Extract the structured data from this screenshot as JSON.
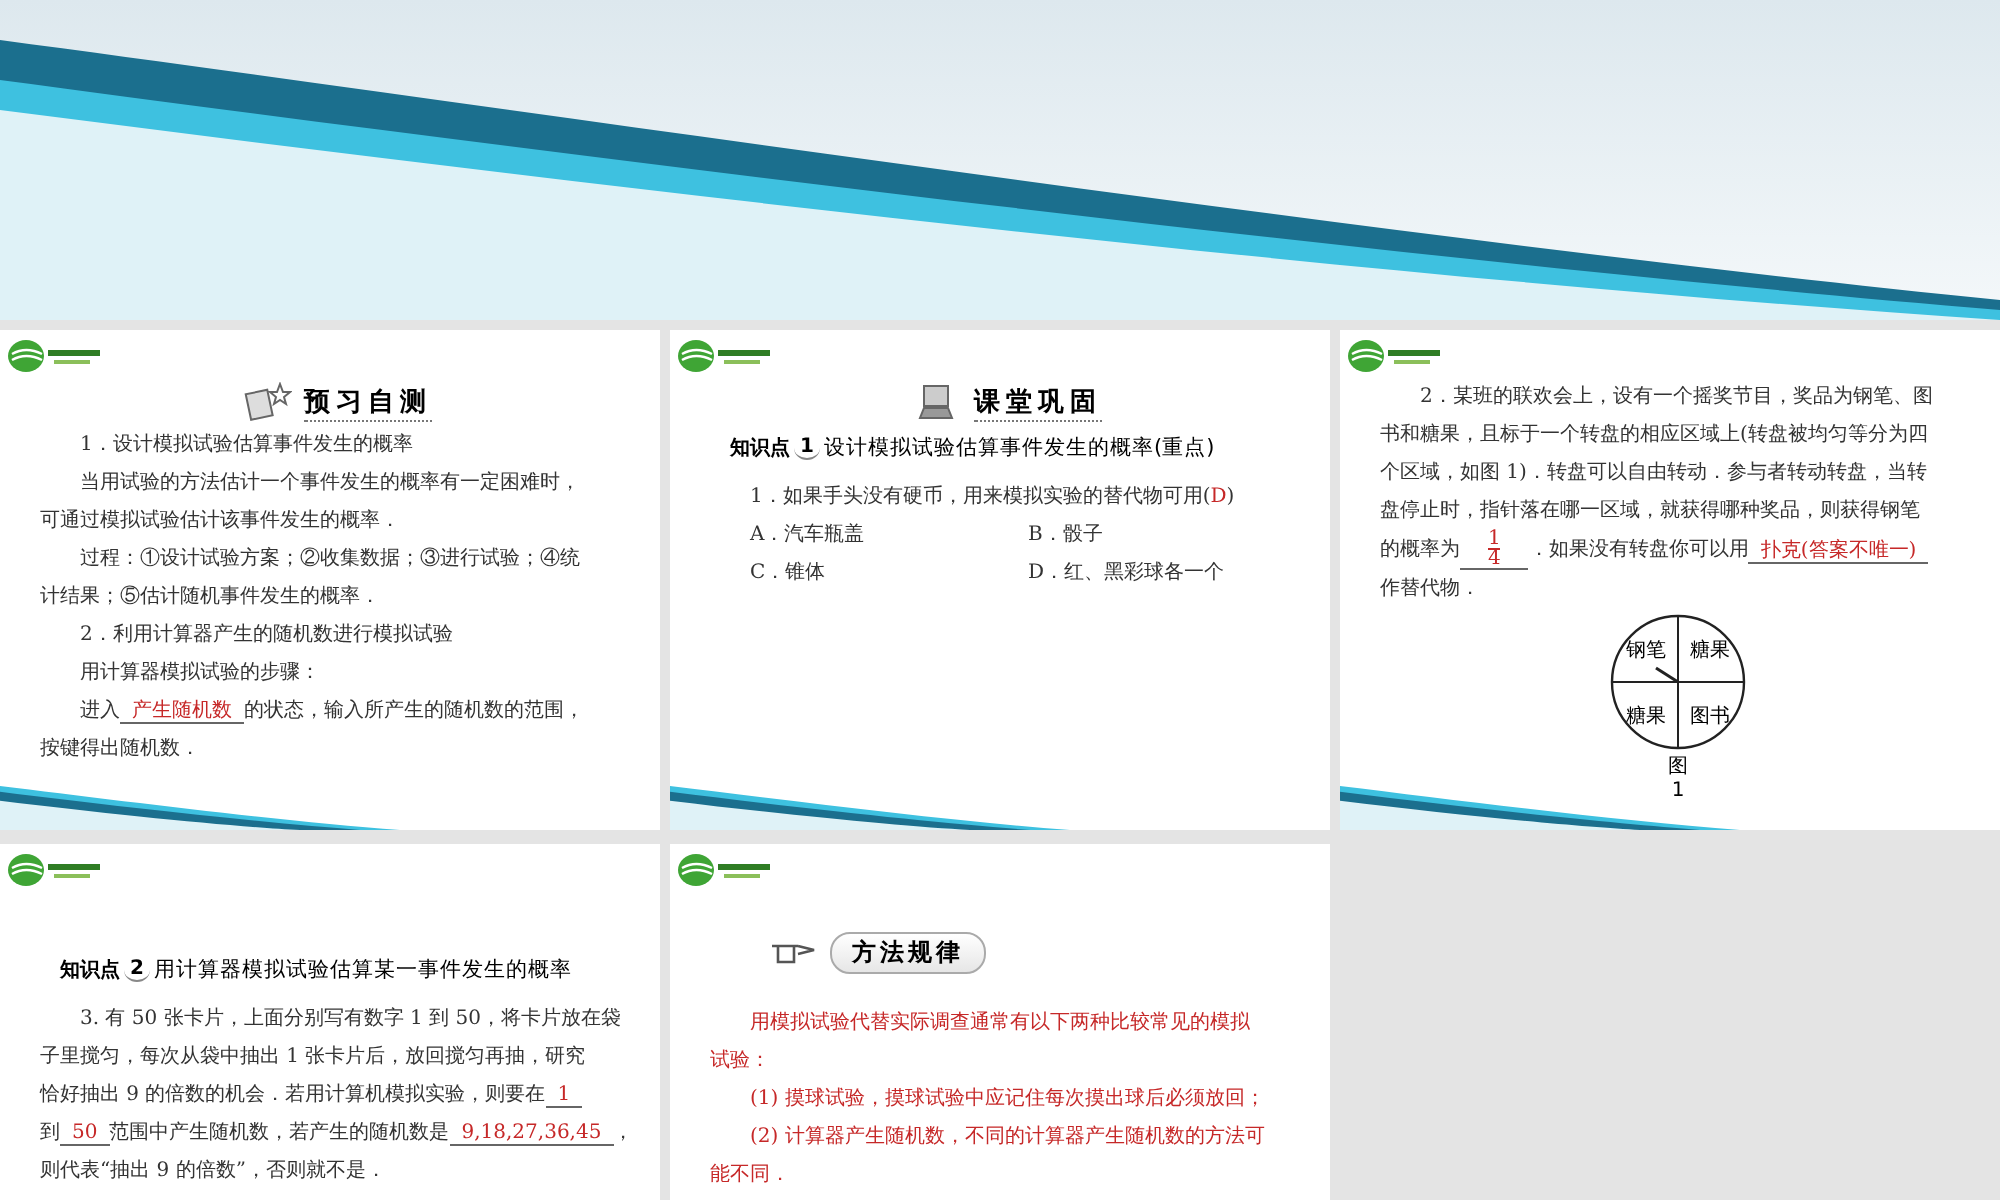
{
  "slides": [
    {
      "kind": "preview",
      "heading": "预习自测",
      "paragraphs": [
        {
          "indent": true,
          "segments": [
            {
              "kind": "text",
              "text": "1．设计模拟试验估算事件发生的概率"
            }
          ]
        },
        {
          "indent": true,
          "segments": [
            {
              "kind": "text",
              "text": "当用试验的方法估计一个事件发生的概率有一定困难时，"
            }
          ]
        },
        {
          "indent": false,
          "segments": [
            {
              "kind": "text",
              "text": "可通过模拟试验估计该事件发生的概率．"
            }
          ]
        },
        {
          "indent": true,
          "segments": [
            {
              "kind": "text",
              "text": "过程：①设计试验方案；②收集数据；③进行试验；④统"
            }
          ]
        },
        {
          "indent": false,
          "segments": [
            {
              "kind": "text",
              "text": "计结果；⑤估计随机事件发生的概率．"
            }
          ]
        },
        {
          "indent": true,
          "segments": [
            {
              "kind": "text",
              "text": "2．利用计算器产生的随机数进行模拟试验"
            }
          ]
        },
        {
          "indent": true,
          "segments": [
            {
              "kind": "text",
              "text": "用计算器模拟试验的步骤："
            }
          ]
        },
        {
          "indent": true,
          "segments": [
            {
              "kind": "text",
              "text": "进入"
            },
            {
              "kind": "answer",
              "text": "产生随机数"
            },
            {
              "kind": "text",
              "text": "的状态，输入所产生的随机数的范围，"
            }
          ]
        },
        {
          "indent": false,
          "segments": [
            {
              "kind": "text",
              "text": "按键得出随机数．"
            }
          ]
        }
      ]
    },
    {
      "kind": "consolidate",
      "heading": "课堂巩固",
      "point": {
        "label": "知识点",
        "number": "1",
        "title": "设计模拟试验估算事件发生的概率(重点)"
      },
      "paragraphs": [
        {
          "indent": true,
          "segments": [
            {
              "kind": "text",
              "text": "1．如果手头没有硬币，用来模拟实验的替代物可用("
            },
            {
              "kind": "note",
              "text": "D"
            },
            {
              "kind": "text",
              "text": ")"
            }
          ]
        }
      ],
      "options": [
        "A．汽车瓶盖",
        "B．骰子",
        "C．锥体",
        "D．红、黑彩球各一个"
      ]
    },
    {
      "kind": "spinner",
      "paragraphs": [
        {
          "indent": true,
          "segments": [
            {
              "kind": "text",
              "text": "2．某班的联欢会上，设有一个摇奖节目，奖品为钢笔、图"
            }
          ]
        },
        {
          "indent": false,
          "segments": [
            {
              "kind": "text",
              "text": "书和糖果，且标于一个转盘的相应区域上(转盘被均匀等分为四"
            }
          ]
        },
        {
          "indent": false,
          "segments": [
            {
              "kind": "text",
              "text": "个区域，如图 1)．转盘可以自由转动．参与者转动转盘，当转"
            }
          ]
        },
        {
          "indent": false,
          "segments": [
            {
              "kind": "text",
              "text": "盘停止时，指针落在哪一区域，就获得哪种奖品，则获得钢笔"
            }
          ]
        },
        {
          "indent": false,
          "segments": [
            {
              "kind": "text",
              "text": "的概率为"
            },
            {
              "kind": "fraction",
              "numerator": "1",
              "denominator": "4"
            },
            {
              "kind": "text",
              "text": "．如果没有转盘你可以用"
            },
            {
              "kind": "answer",
              "text": "扑克(答案不唯一)"
            }
          ]
        },
        {
          "indent": false,
          "segments": [
            {
              "kind": "text",
              "text": "作替代物．"
            }
          ]
        }
      ],
      "spinner": {
        "sectors": [
          "钢笔",
          "糖果",
          "糖果",
          "图书"
        ],
        "caption": [
          "图",
          "1"
        ]
      }
    },
    {
      "kind": "knowledge",
      "point": {
        "label": "知识点",
        "number": "2",
        "title": "用计算器模拟试验估算某一事件发生的概率"
      },
      "paragraphs": [
        {
          "indent": true,
          "segments": [
            {
              "kind": "text",
              "text": "3. 有 50 张卡片，上面分别写有数字 1 到 50，将卡片放在袋"
            }
          ]
        },
        {
          "indent": false,
          "segments": [
            {
              "kind": "text",
              "text": "子里搅匀，每次从袋中抽出 1 张卡片后，放回搅匀再抽，研究"
            }
          ]
        },
        {
          "indent": false,
          "segments": [
            {
              "kind": "text",
              "text": "恰好抽出 9 的倍数的机会．若用计算机模拟实验，则要在"
            },
            {
              "kind": "answer",
              "text": "1"
            }
          ]
        },
        {
          "indent": false,
          "segments": [
            {
              "kind": "text",
              "text": "到"
            },
            {
              "kind": "answer",
              "text": "50"
            },
            {
              "kind": "text",
              "text": "范围中产生随机数，若产生的随机数是"
            },
            {
              "kind": "answer",
              "text": "9,18,27,36,45"
            },
            {
              "kind": "text",
              "text": "，"
            }
          ]
        },
        {
          "indent": false,
          "segments": [
            {
              "kind": "text",
              "text": "则代表“抽出 9 的倍数”，否则就不是．"
            }
          ]
        }
      ]
    },
    {
      "kind": "method",
      "heading": "方法规律",
      "paragraphs": [
        {
          "indent": true,
          "segments": [
            {
              "kind": "note",
              "text": "用模拟试验代替实际调查通常有以下两种比较常见的模拟"
            }
          ]
        },
        {
          "indent": false,
          "segments": [
            {
              "kind": "note",
              "text": "试验："
            }
          ]
        },
        {
          "indent": true,
          "segments": [
            {
              "kind": "note",
              "text": "(1) 摸球试验，摸球试验中应记住每次摸出球后必须放回；"
            }
          ]
        },
        {
          "indent": true,
          "segments": [
            {
              "kind": "note",
              "text": "(2) 计算器产生随机数，不同的计算器产生随机数的方法可"
            }
          ]
        },
        {
          "indent": false,
          "segments": [
            {
              "kind": "note",
              "text": "能不同．"
            }
          ]
        }
      ]
    }
  ]
}
